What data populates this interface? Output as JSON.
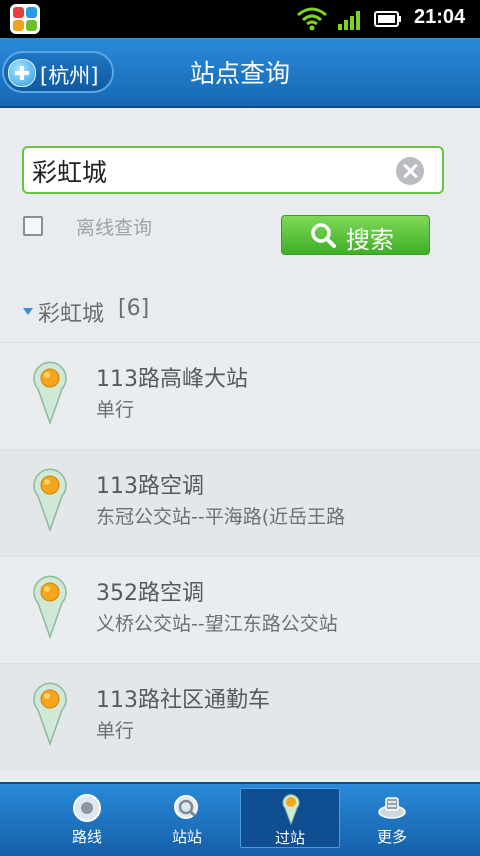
{
  "status_bar": {
    "time": "21:04"
  },
  "header": {
    "city_button": "[杭州]",
    "title": "站点查询"
  },
  "search": {
    "query": "彩虹城",
    "offline_label": "离线查询",
    "search_button": "搜索"
  },
  "results": {
    "group_title": "彩虹城",
    "group_count": "[6]",
    "items": [
      {
        "title": "113路高峰大站",
        "subtitle": "单行"
      },
      {
        "title": "113路空调",
        "subtitle": "东冠公交站--平海路(近岳王路"
      },
      {
        "title": "352路空调",
        "subtitle": "义桥公交站--望江东路公交站"
      },
      {
        "title": "113路社区通勤车",
        "subtitle": "单行"
      }
    ]
  },
  "bottom_nav": {
    "items": [
      {
        "label": "路线",
        "icon": "route-icon"
      },
      {
        "label": "站站",
        "icon": "station-search-icon"
      },
      {
        "label": "过站",
        "icon": "location-pin-icon",
        "active": true
      },
      {
        "label": "更多",
        "icon": "tools-icon"
      }
    ]
  },
  "colors": {
    "accent": "#1e7bcc",
    "search_green": "#4cba2f",
    "pin_orange": "#f4a51c"
  }
}
